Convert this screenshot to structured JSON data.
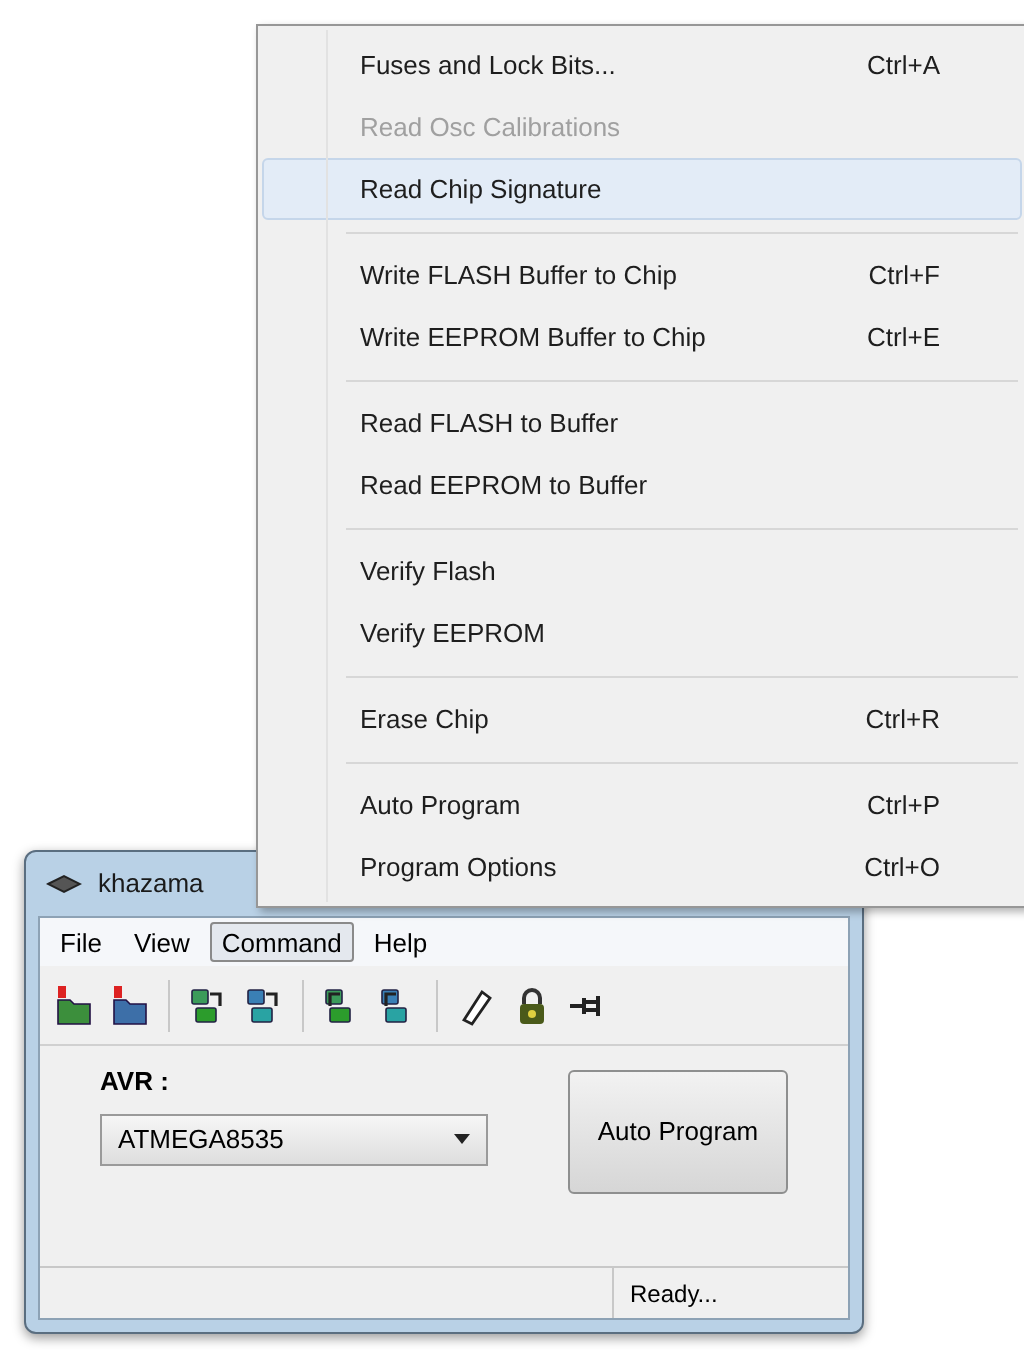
{
  "window": {
    "title": "khazama"
  },
  "menu_bar": [
    {
      "label": "File",
      "selected": false
    },
    {
      "label": "View",
      "selected": false
    },
    {
      "label": "Command",
      "selected": true
    },
    {
      "label": "Help",
      "selected": false
    }
  ],
  "command_menu": [
    {
      "kind": "item",
      "label": "Fuses and Lock Bits...",
      "shortcut": "Ctrl+A",
      "disabled": false,
      "selected": false
    },
    {
      "kind": "item",
      "label": "Read Osc Calibrations",
      "disabled": true,
      "selected": false
    },
    {
      "kind": "item",
      "label": "Read Chip Signature",
      "disabled": false,
      "selected": true
    },
    {
      "kind": "separator"
    },
    {
      "kind": "item",
      "label": "Write FLASH Buffer to Chip",
      "shortcut": "Ctrl+F",
      "disabled": false,
      "selected": false
    },
    {
      "kind": "item",
      "label": "Write EEPROM Buffer to Chip",
      "shortcut": "Ctrl+E",
      "disabled": false,
      "selected": false
    },
    {
      "kind": "separator"
    },
    {
      "kind": "item",
      "label": "Read FLASH to Buffer",
      "disabled": false,
      "selected": false
    },
    {
      "kind": "item",
      "label": "Read EEPROM to Buffer",
      "disabled": false,
      "selected": false
    },
    {
      "kind": "separator"
    },
    {
      "kind": "item",
      "label": "Verify Flash",
      "disabled": false,
      "selected": false
    },
    {
      "kind": "item",
      "label": "Verify EEPROM",
      "disabled": false,
      "selected": false
    },
    {
      "kind": "separator"
    },
    {
      "kind": "item",
      "label": "Erase Chip",
      "shortcut": "Ctrl+R",
      "disabled": false,
      "selected": false
    },
    {
      "kind": "separator"
    },
    {
      "kind": "item",
      "label": "Auto Program",
      "shortcut": "Ctrl+P",
      "disabled": false,
      "selected": false
    },
    {
      "kind": "item",
      "label": "Program Options",
      "shortcut": "Ctrl+O",
      "disabled": false,
      "selected": false
    }
  ],
  "avr": {
    "label": "AVR :",
    "value": "ATMEGA8535"
  },
  "auto_program_button": "Auto Program",
  "status_bar": {
    "status": "Ready..."
  }
}
